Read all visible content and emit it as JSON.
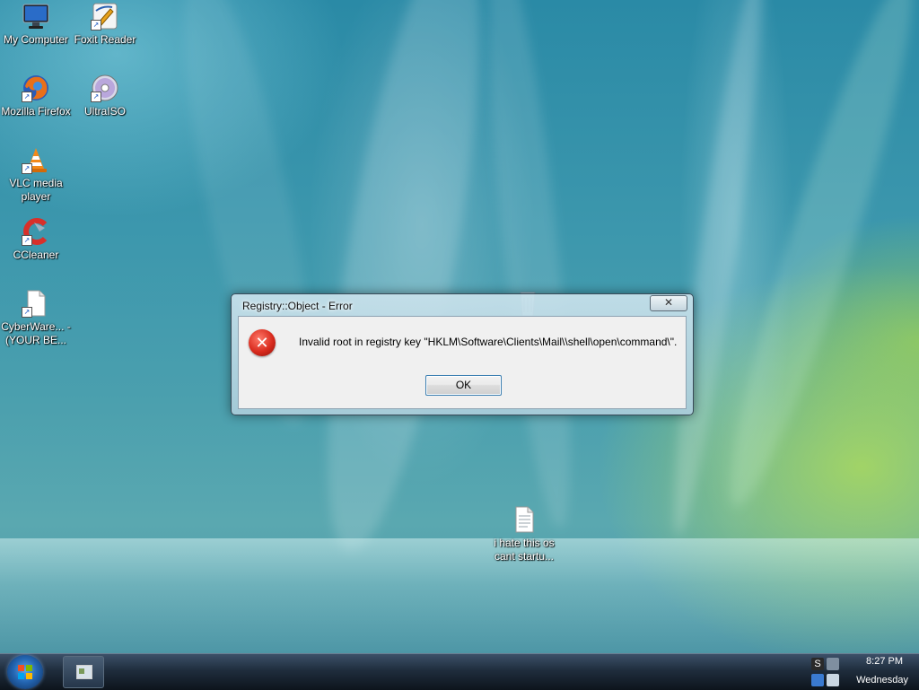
{
  "desktop": {
    "icons": [
      {
        "name": "my-computer",
        "label": "My Computer",
        "icon": "monitor-icon"
      },
      {
        "name": "foxit-reader",
        "label": "Foxit Reader",
        "icon": "foxit-pen-icon"
      },
      {
        "name": "mozilla-firefox",
        "label": "Mozilla Firefox",
        "icon": "firefox-icon"
      },
      {
        "name": "ultraiso",
        "label": "UltraISO",
        "icon": "disc-icon"
      },
      {
        "name": "vlc-media-player",
        "label": "VLC media player",
        "icon": "vlc-cone-icon"
      },
      {
        "name": "ccleaner",
        "label": "CCleaner",
        "icon": "ccleaner-icon"
      },
      {
        "name": "cyberware",
        "label": "CyberWare... - (YOUR BE...",
        "icon": "document-icon"
      },
      {
        "name": "text-file",
        "label": "i hate this os cant startu...",
        "icon": "text-file-icon"
      }
    ],
    "recycle_bin": {
      "icon": "recycle-bin-icon"
    }
  },
  "dialog": {
    "title": "Registry::Object - Error",
    "close_glyph": "✕",
    "icon": "error-icon",
    "message": "Invalid root in registry key \"HKLM\\Software\\Clients\\Mail\\\\shell\\open\\command\\\".",
    "ok_label": "OK"
  },
  "taskbar": {
    "start_icon": "windows-start-orb-icon",
    "tray": {
      "time": "8:27 PM",
      "day": "Wednesday"
    }
  },
  "colors": {
    "desktop_base": "#3c97ad",
    "desktop_green": "#afdc5a",
    "dialog_frame": "#aacdda",
    "taskbar": "#1f2d3d",
    "error_red": "#d92b1e"
  }
}
